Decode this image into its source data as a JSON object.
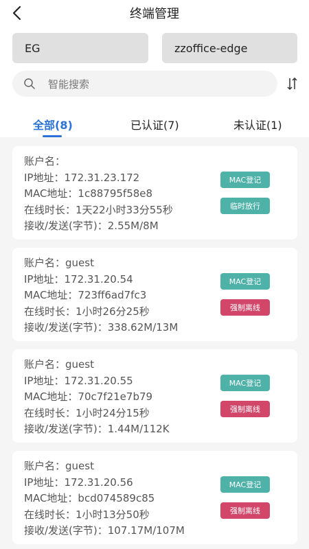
{
  "header": {
    "title": "终端管理"
  },
  "filters": {
    "primary": "EG",
    "secondary": "zzoffice-edge"
  },
  "search": {
    "placeholder": "智能搜索"
  },
  "tabs": [
    {
      "label": "全部(8)",
      "active": true
    },
    {
      "label": "已认证(7)",
      "active": false
    },
    {
      "label": "未认证(1)",
      "active": false
    }
  ],
  "labels": {
    "account": "账户名：",
    "ip": "IP地址：",
    "mac": "MAC地址：",
    "online": "在线时长：",
    "traffic": "接收/发送(字节)："
  },
  "devices": [
    {
      "account": "",
      "ip": "172.31.23.172",
      "mac": "1c88795f58e8",
      "online": "1天22小时33分55秒",
      "traffic": "2.55M/8M",
      "mac_button": "MAC登记",
      "action_button": "临时放行",
      "action_color": "#4fb2a8"
    },
    {
      "account": "guest",
      "ip": "172.31.20.54",
      "mac": "723ff6ad7fc3",
      "online": "1小时26分25秒",
      "traffic": "338.62M/13M",
      "mac_button": "MAC登记",
      "action_button": "强制离线",
      "action_color": "#d2466a"
    },
    {
      "account": "guest",
      "ip": "172.31.20.55",
      "mac": "70c7f21e7b79",
      "online": "1小时24分15秒",
      "traffic": "1.44M/112K",
      "mac_button": "MAC登记",
      "action_button": "强制离线",
      "action_color": "#d2466a"
    },
    {
      "account": "guest",
      "ip": "172.31.20.56",
      "mac": "bcd074589c85",
      "online": "1小时13分50秒",
      "traffic": "107.17M/107M",
      "mac_button": "MAC登记",
      "action_button": "强制离线",
      "action_color": "#d2466a"
    }
  ]
}
